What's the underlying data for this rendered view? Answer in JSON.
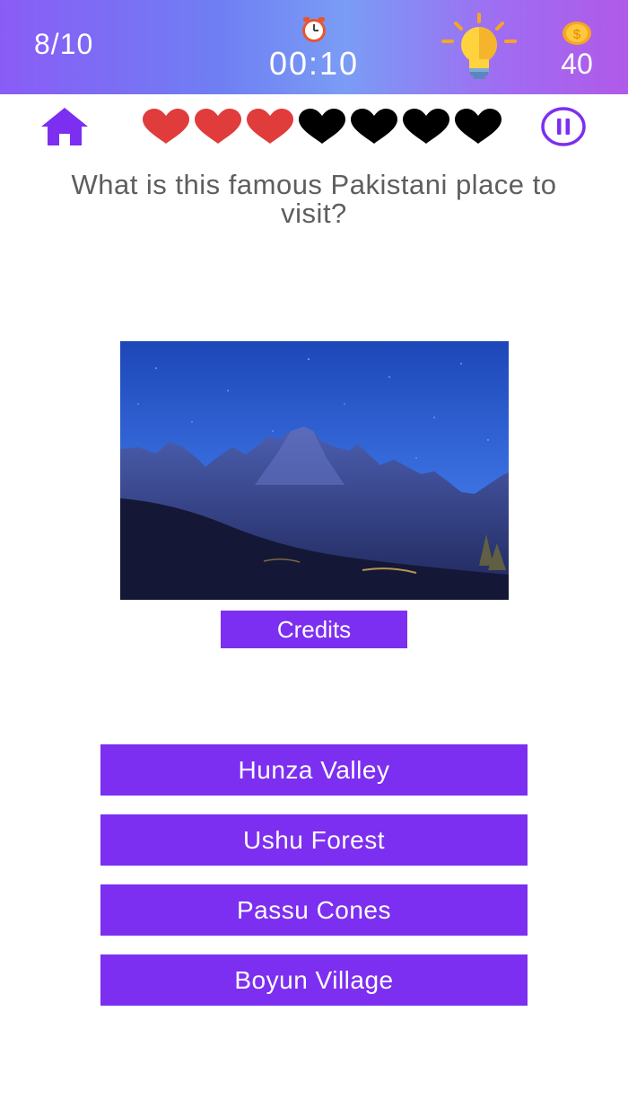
{
  "header": {
    "progress": "8/10",
    "timer": "00:10",
    "coins": "40",
    "coin_symbol": "$"
  },
  "lives": {
    "total": 7,
    "remaining": 3,
    "filled_color": "#e03c3c",
    "empty_color": "#000000"
  },
  "colors": {
    "accent": "#7c2ff0",
    "question_text": "#5e5e5e"
  },
  "question": {
    "text": "What is this famous Pakistani place to visit?"
  },
  "credits_label": "Credits",
  "answers": [
    {
      "label": "Hunza Valley"
    },
    {
      "label": "Ushu Forest"
    },
    {
      "label": "Passu Cones"
    },
    {
      "label": "Boyun Village"
    }
  ]
}
